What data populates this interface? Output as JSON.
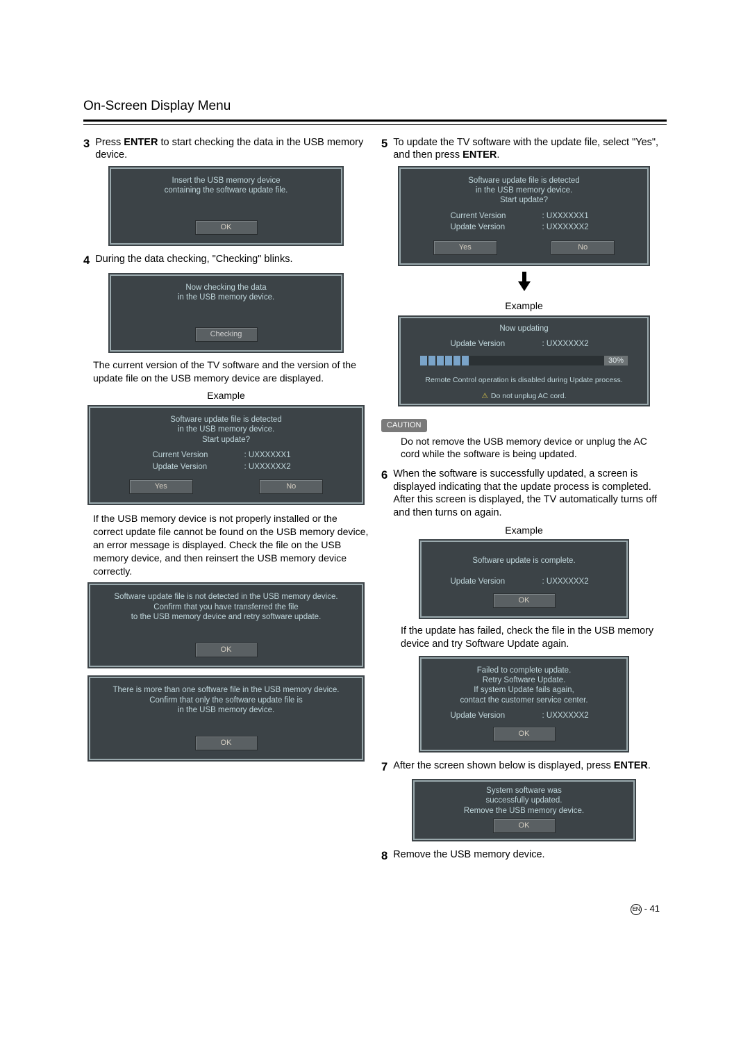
{
  "header": {
    "title": "On-Screen Display Menu"
  },
  "left": {
    "s3": {
      "num": "3",
      "pre": "Press ",
      "key": "ENTER",
      "post": " to start checking the data in the USB memory device."
    },
    "scr1": {
      "l1": "Insert the USB memory device",
      "l2": "containing the software update file.",
      "ok": "OK"
    },
    "s4": {
      "num": "4",
      "text": "During the data checking, \"Checking\" blinks."
    },
    "scr2": {
      "l1": "Now checking the data",
      "l2": "in the USB memory device.",
      "checking": "Checking"
    },
    "para1": "The current version of the TV software and the version of the update ﬁle on the USB memory device are displayed.",
    "example": "Example",
    "scr3": {
      "l1": "Software update file is detected",
      "l2": "in the USB memory device.",
      "l3": "Start update?",
      "cur_lbl": "Current Version",
      "cur_val": ":  UXXXXXX1",
      "upd_lbl": "Update Version",
      "upd_val": ":  UXXXXXX2",
      "yes": "Yes",
      "no": "No"
    },
    "para2": "If the USB memory device is not properly installed or the correct update ﬁle cannot be found on the USB memory device, an error message is displayed. Check the ﬁle on the USB memory device, and then reinsert the USB memory device correctly.",
    "scr4": {
      "l1": "Software update file is not detected in the USB memory device.",
      "l2": "Confirm that you have transferred the file",
      "l3": "to the USB memory device and retry software update.",
      "ok": "OK"
    },
    "scr5": {
      "l1": "There is more than one software file in the USB memory device.",
      "l2": "Confirm that only the software update file is",
      "l3": "in the USB memory device.",
      "ok": "OK"
    }
  },
  "right": {
    "s5": {
      "num": "5",
      "text_a": "To update the TV software with the update ﬁle, select \"Yes\", and then press ",
      "key": "ENTER",
      "text_b": "."
    },
    "scr6": {
      "l1": "Software update file is detected",
      "l2": "in the USB memory device.",
      "l3": "Start update?",
      "cur_lbl": "Current Version",
      "cur_val": ":  UXXXXXX1",
      "upd_lbl": "Update Version",
      "upd_val": ":  UXXXXXX2",
      "yes": "Yes",
      "no": "No"
    },
    "example": "Example",
    "scr7": {
      "title": "Now updating",
      "upd_lbl": "Update Version",
      "upd_val": ":  UXXXXXX2",
      "pct": "30%",
      "warn1": "Remote Control operation is disabled during Update process.",
      "warn2": "Do not unplug AC cord."
    },
    "caution_label": "CAUTION",
    "caution_text": "Do not remove the USB memory device or unplug the AC cord while the software is being updated.",
    "s6": {
      "num": "6",
      "text1": "When the software is successfully updated, a screen is displayed indicating that the update process is completed.",
      "text2": "After this screen is displayed, the TV automatically turns off and then turns on again."
    },
    "scr8": {
      "l1": "Software update is complete.",
      "upd_lbl": "Update Version",
      "upd_val": ":  UXXXXXX2",
      "ok": "OK"
    },
    "para3": "If the update has failed, check the ﬁle in the USB memory device and try Software Update again.",
    "scr9": {
      "l1": "Failed to complete update.",
      "l2": "Retry Software Update.",
      "l3": "If system Update fails again,",
      "l4": "contact the customer service center.",
      "upd_lbl": "Update Version",
      "upd_val": ":  UXXXXXX2",
      "ok": "OK"
    },
    "s7": {
      "num": "7",
      "text_a": "After the screen shown below is displayed, press ",
      "key": "ENTER",
      "text_b": "."
    },
    "scr10": {
      "l1": "System software was",
      "l2": "successfully updated.",
      "l3": "Remove the USB memory device.",
      "ok": "OK"
    },
    "s8": {
      "num": "8",
      "text": "Remove the USB memory device."
    }
  },
  "footer": {
    "lang": "EN",
    "dash": " - ",
    "num": "41"
  }
}
